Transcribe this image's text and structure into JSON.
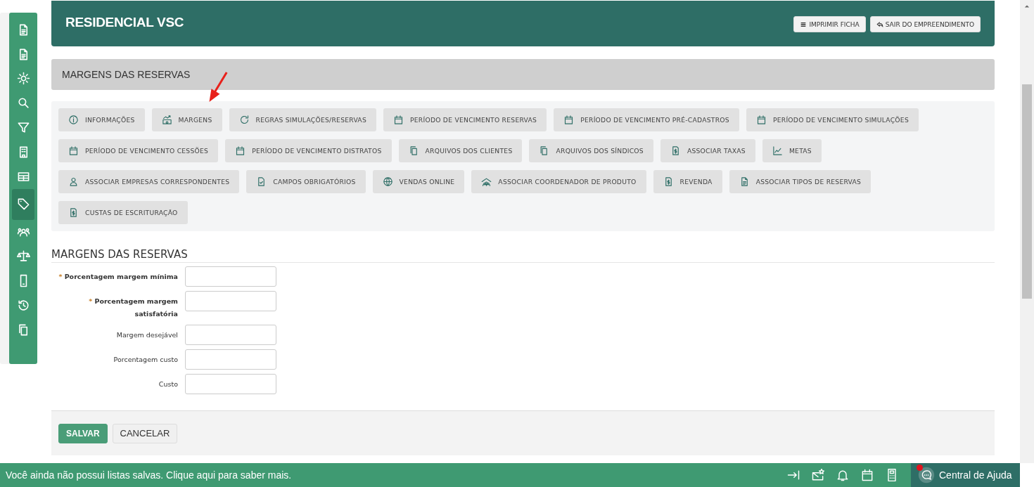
{
  "sidebar": {
    "items": [
      {
        "selected": false
      },
      {
        "selected": false
      },
      {
        "selected": false
      },
      {
        "selected": false
      },
      {
        "selected": false
      },
      {
        "selected": false
      },
      {
        "selected": false
      },
      {
        "selected": true
      },
      {
        "selected": false
      },
      {
        "selected": false
      },
      {
        "selected": false
      },
      {
        "selected": false
      },
      {
        "selected": false
      }
    ]
  },
  "header": {
    "title": "RESIDENCIAL VSC",
    "buttons": [
      {
        "label": "IMPRIMIR FICHA"
      },
      {
        "label": "SAIR DO EMPREENDIMENTO"
      }
    ]
  },
  "section_bar": {
    "title": "MARGENS DAS RESERVAS"
  },
  "menu_buttons": [
    {
      "label": "INFORMAÇÕES"
    },
    {
      "label": "MARGENS"
    },
    {
      "label": "REGRAS SIMULAÇÕES/RESERVAS"
    },
    {
      "label": "PERÍODO DE VENCIMENTO RESERVAS"
    },
    {
      "label": "PERÍODO DE VENCIMENTO PRÉ-CADASTROS"
    },
    {
      "label": "PERÍODO DE VENCIMENTO SIMULAÇÕES"
    },
    {
      "label": "PERÍODO DE VENCIMENTO CESSÕES"
    },
    {
      "label": "PERÍODO DE VENCIMENTO DISTRATOS"
    },
    {
      "label": "ARQUIVOS DOS CLIENTES"
    },
    {
      "label": "ARQUIVOS DOS SÍNDICOS"
    },
    {
      "label": "ASSOCIAR TAXAS"
    },
    {
      "label": "METAS"
    },
    {
      "label": "ASSOCIAR EMPRESAS CORRESPONDENTES"
    },
    {
      "label": "CAMPOS OBRIGATÓRIOS"
    },
    {
      "label": "VENDAS ONLINE"
    },
    {
      "label": "ASSOCIAR COORDENADOR DE PRODUTO"
    },
    {
      "label": "REVENDA"
    },
    {
      "label": "ASSOCIAR TIPOS DE RESERVAS"
    },
    {
      "label": "CUSTAS DE ESCRITURAÇÃO"
    }
  ],
  "form": {
    "title": "MARGENS DAS RESERVAS",
    "fields": [
      {
        "label": "Porcentagem margem mínima",
        "required": true,
        "mark": "*"
      },
      {
        "label": "Porcentagem margem satisfatória",
        "required": true,
        "mark": "*"
      },
      {
        "label": "Margem desejável",
        "required": false
      },
      {
        "label": "Porcentagem custo",
        "required": false
      },
      {
        "label": "Custo",
        "required": false
      }
    ],
    "buttons": [
      {
        "kind": "primary",
        "label": "SALVAR"
      },
      {
        "kind": "secondary",
        "label": "CANCELAR"
      }
    ]
  },
  "status_bar": {
    "message": "Você ainda não possui listas salvas. Clique aqui para saber mais.",
    "help": {
      "label": "Central de Ajuda",
      "notification": true
    }
  }
}
